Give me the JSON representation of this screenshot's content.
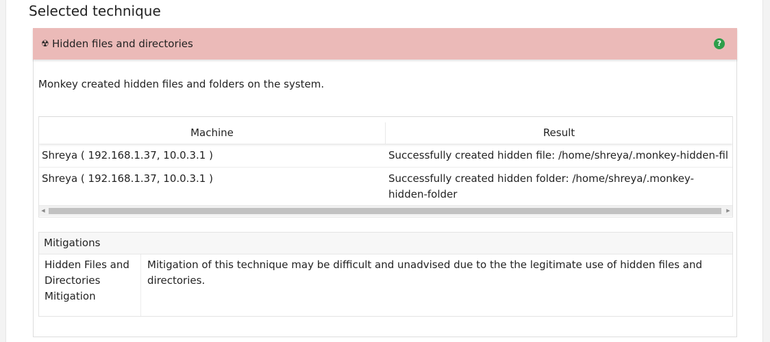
{
  "section_title": "Selected technique",
  "technique": {
    "icon": "radiation-icon",
    "title": "Hidden files and directories",
    "help_icon": "question-circle-icon",
    "header_color": "#ebbab8",
    "help_color": "#2e9e4a",
    "description": "Monkey created hidden files and folders on the system."
  },
  "table": {
    "columns": [
      "Machine",
      "Result"
    ],
    "rows": [
      {
        "machine": "Shreya ( 192.168.1.37, 10.0.3.1 )",
        "result": "Successfully created hidden file: /home/shreya/.monkey-hidden-file"
      },
      {
        "machine": "Shreya ( 192.168.1.37, 10.0.3.1 )",
        "result": "Successfully created hidden folder: /home/shreya/.monkey-hidden-folder"
      }
    ]
  },
  "mitigations": {
    "header": "Mitigations",
    "items": [
      {
        "name": "Hidden Files and Directories Mitigation",
        "description": "Mitigation of this technique may be difficult and unadvised due to the the legitimate use of hidden files and directories."
      }
    ]
  }
}
